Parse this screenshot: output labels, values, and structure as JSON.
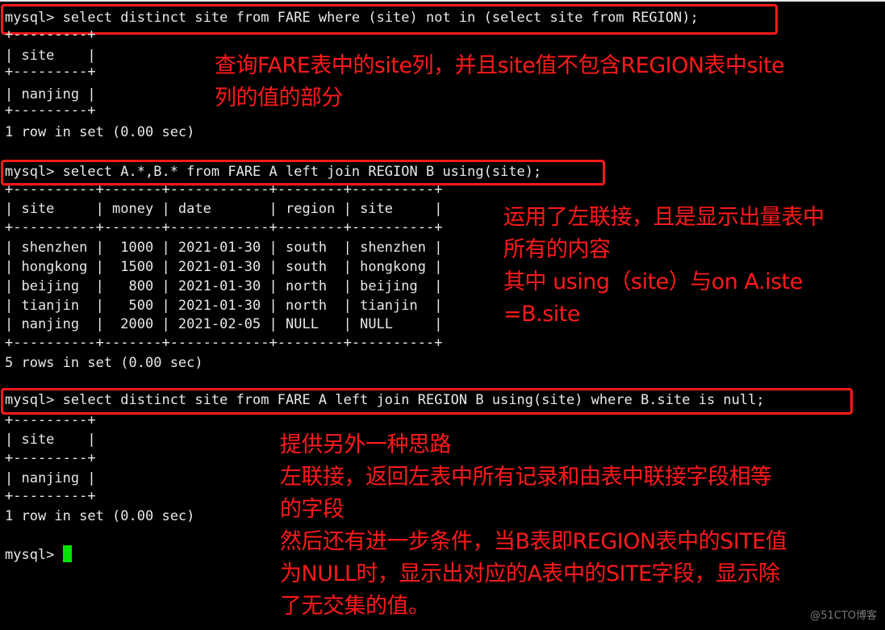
{
  "queries": [
    {
      "command": "mysql> select distinct site from FARE where (site) not in (select site from REGION);",
      "output": [
        "+---------+",
        "| site    |",
        "+---------+",
        "| nanjing |",
        "+---------+",
        "1 row in set (0.00 sec)"
      ],
      "note": "查询FARE表中的site列，并且site值不包含REGION表中site\n列的值的部分"
    },
    {
      "command": "mysql> select A.*,B.* from FARE A left join REGION B using(site);",
      "output": [
        "+----------+-------+------------+--------+----------+",
        "| site     | money | date       | region | site     |",
        "+----------+-------+------------+--------+----------+",
        "| shenzhen |  1000 | 2021-01-30 | south  | shenzhen |",
        "| hongkong |  1500 | 2021-01-30 | south  | hongkong |",
        "| beijing  |   800 | 2021-01-30 | north  | beijing  |",
        "| tianjin  |   500 | 2021-01-30 | north  | tianjin  |",
        "| nanjing  |  2000 | 2021-02-05 | NULL   | NULL     |",
        "+----------+-------+------------+--------+----------+",
        "5 rows in set (0.00 sec)"
      ],
      "table": {
        "columns": [
          "site",
          "money",
          "date",
          "region",
          "site"
        ],
        "rows": [
          [
            "shenzhen",
            "1000",
            "2021-01-30",
            "south",
            "shenzhen"
          ],
          [
            "hongkong",
            "1500",
            "2021-01-30",
            "south",
            "hongkong"
          ],
          [
            "beijing",
            "800",
            "2021-01-30",
            "north",
            "beijing"
          ],
          [
            "tianjin",
            "500",
            "2021-01-30",
            "north",
            "tianjin"
          ],
          [
            "nanjing",
            "2000",
            "2021-02-05",
            "NULL",
            "NULL"
          ]
        ]
      },
      "note": "运用了左联接，且是显示出量表中\n所有的内容\n其中 using（site）与on A.iste\n=B.site"
    },
    {
      "command": "mysql> select distinct site from FARE A left join REGION B using(site) where B.site is null;",
      "output": [
        "+---------+",
        "| site    |",
        "+---------+",
        "| nanjing |",
        "+---------+",
        "1 row in set (0.00 sec)"
      ],
      "note": "提供另外一种思路\n左联接，返回左表中所有记录和由表中联接字段相等\n的字段\n然后还有进一步条件，当B表即REGION表中的SITE值\n为NULL时，显示出对应的A表中的SITE字段，显示除\n了无交集的值。"
    }
  ],
  "prompt": "mysql> ",
  "watermark": "@51CTO博客",
  "colors": {
    "background": "#000000",
    "terminal_text": "#e8e8e8",
    "annotation": "#ff1a1a",
    "cursor": "#00e600"
  }
}
